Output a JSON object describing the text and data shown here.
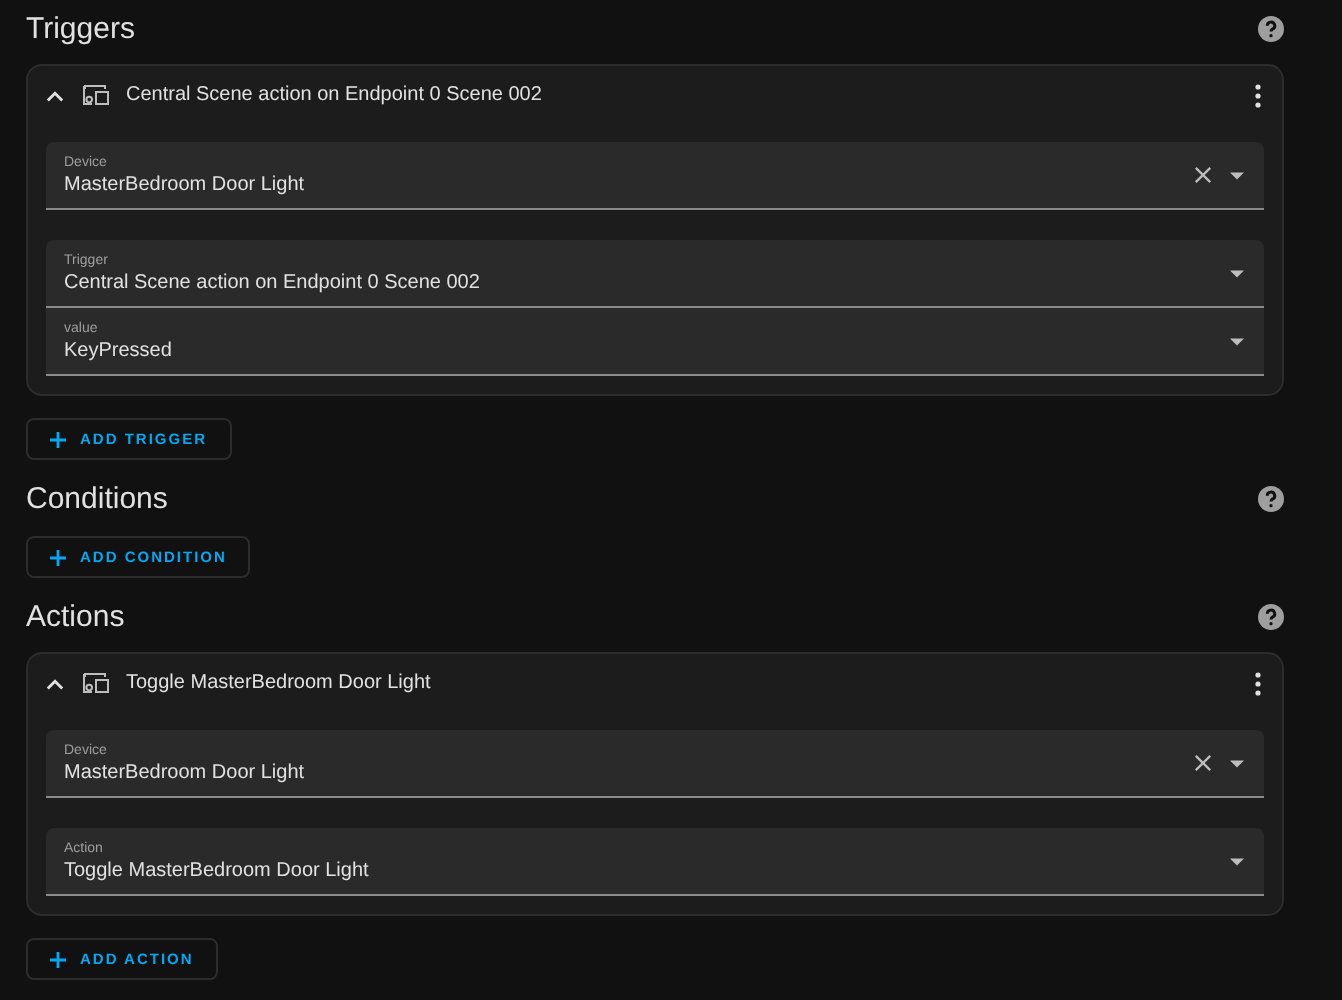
{
  "sections": [
    {
      "title": "Triggers",
      "card": {
        "title": "Central Scene action on Endpoint 0 Scene 002",
        "expanded": true,
        "fields": [
          {
            "label": "Device",
            "value": "MasterBedroom Door Light",
            "clearable": true,
            "joined": false
          },
          {
            "label": "Trigger",
            "value": "Central Scene action on Endpoint 0 Scene 002",
            "clearable": false,
            "joined": false
          },
          {
            "label": "value",
            "value": "KeyPressed",
            "clearable": false,
            "joined": true
          }
        ]
      },
      "add_button": "ADD TRIGGER"
    },
    {
      "title": "Conditions",
      "add_button": "ADD CONDITION"
    },
    {
      "title": "Actions",
      "card": {
        "title": "Toggle MasterBedroom Door Light",
        "expanded": true,
        "fields": [
          {
            "label": "Device",
            "value": "MasterBedroom Door Light",
            "clearable": true,
            "joined": false
          },
          {
            "label": "Action",
            "value": "Toggle MasterBedroom Door Light",
            "clearable": false,
            "joined": false
          }
        ]
      },
      "add_button": "ADD ACTION"
    }
  ]
}
